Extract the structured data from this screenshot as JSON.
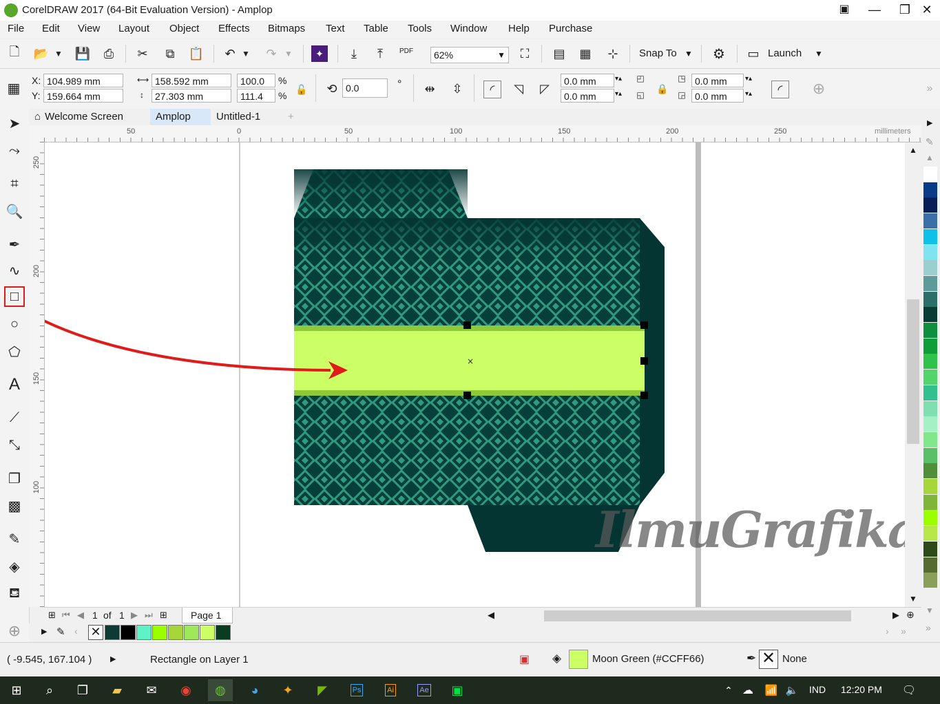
{
  "window": {
    "title": "CorelDRAW 2017 (64-Bit Evaluation Version) - Amplop"
  },
  "menu": {
    "items": [
      "File",
      "Edit",
      "View",
      "Layout",
      "Object",
      "Effects",
      "Bitmaps",
      "Text",
      "Table",
      "Tools",
      "Window",
      "Help",
      "Purchase"
    ]
  },
  "standard_toolbar": {
    "zoom": "62%",
    "snap_label": "Snap To",
    "launch_label": "Launch",
    "pdf_label": "PDF"
  },
  "property_bar": {
    "x_label": "X:",
    "y_label": "Y:",
    "x_value": "104.989 mm",
    "y_value": "159.664 mm",
    "width": "158.592 mm",
    "height": "27.303 mm",
    "scale_w": "100.0",
    "scale_h": "111.4",
    "percent": "%",
    "rotation": "0.0",
    "degree": "°",
    "corner_tl": "0.0 mm",
    "corner_bl": "0.0 mm",
    "corner_tr": "0.0 mm",
    "corner_br": "0.0 mm"
  },
  "tabs": [
    {
      "label": "Welcome Screen",
      "active": false
    },
    {
      "label": "Amplop",
      "active": true
    },
    {
      "label": "Untitled-1",
      "active": false
    }
  ],
  "rulers": {
    "h_ticks": [
      "50",
      "0",
      "50",
      "100",
      "150",
      "200",
      "250"
    ],
    "units": "millimeters",
    "v_ticks": [
      "250",
      "200",
      "150",
      "100"
    ]
  },
  "page_nav": {
    "current": "1",
    "of": "of",
    "total": "1",
    "page_tab": "Page 1"
  },
  "status": {
    "coordinates": "( -9.545, 167.104 )",
    "object_info": "Rectangle on Layer 1",
    "fill_name": "Moon Green (#CCFF66)",
    "outline_name": "None"
  },
  "watermark": "IlmuGrafika.id",
  "taskbar": {
    "language": "IND",
    "time": "12:20 PM",
    "ps": "Ps",
    "ai": "Ai",
    "ae": "Ae"
  },
  "colors": {
    "envelope_dark": "#043532",
    "envelope_pattern": "#2f9a80",
    "band_fill": "#CCFF66",
    "band_edge": "#8fc93a",
    "arrow": "#e11a1a"
  },
  "palette_right": [
    "#ffffff",
    "#0a3b8a",
    "#071e57",
    "#3a6fa8",
    "#0fc0e8",
    "#7fe3f0",
    "#9bcfcf",
    "#5f9a9a",
    "#2b6f6a",
    "#0a3c36",
    "#0e8f3f",
    "#119c3a",
    "#31c24a",
    "#52d46a",
    "#32c08f",
    "#7ee0b0",
    "#a6f0c6",
    "#80e88a",
    "#5bbf6a",
    "#4f8f3a",
    "#a6d63a",
    "#7fb53a",
    "#9bff00",
    "#b6e84a",
    "#2d4a1a",
    "#556b2f",
    "#8aa05a"
  ],
  "palette_doc": [
    "#0d3b33",
    "#000000",
    "#5ff2c8",
    "#9bff00",
    "#a6d63a",
    "#9ee85a",
    "#ccff66",
    "#0a3d1f"
  ]
}
